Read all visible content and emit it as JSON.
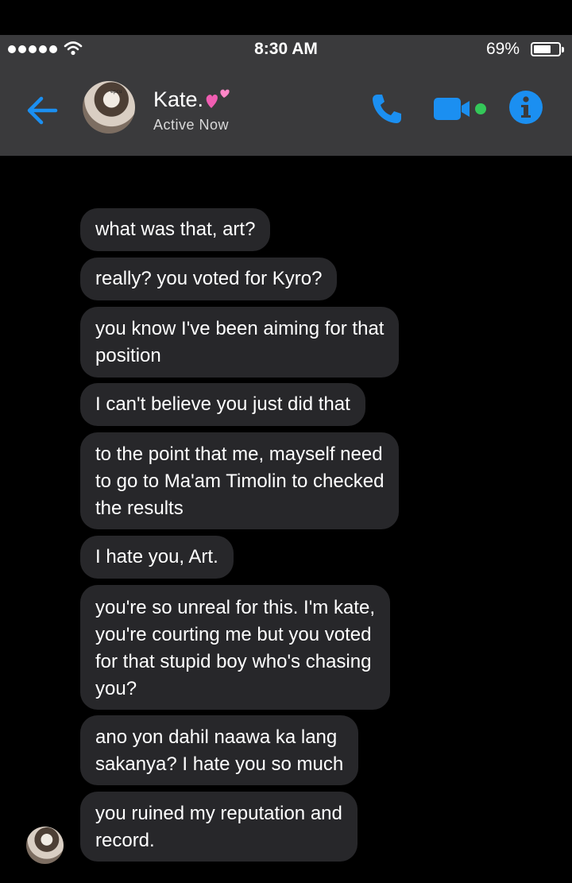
{
  "status_bar": {
    "time": "8:30 AM",
    "battery": "69%",
    "battery_level": 0.69
  },
  "header": {
    "contact_name": "Kate.",
    "contact_status": "Active Now",
    "avatar_tag": "epcu"
  },
  "messages": [
    {
      "text": "what was that, art?"
    },
    {
      "text": "really? you voted for Kyro?"
    },
    {
      "text": "you know I've been aiming for that\nposition"
    },
    {
      "text": "I can't believe you just did that"
    },
    {
      "text": "to the point that me, mayself need\nto go to Ma'am Timolin to checked\nthe results"
    },
    {
      "text": "I hate you, Art."
    },
    {
      "text": "you're so unreal for this. I'm kate,\nyou're courting me but you voted\nfor that stupid boy who's chasing\nyou?"
    },
    {
      "text": "ano yon dahil naawa ka lang\nsakanya? I hate you so much"
    },
    {
      "text": "you ruined my reputation and\nrecord."
    }
  ],
  "colors": {
    "accent": "#1b8ff1",
    "online": "#34c759",
    "bubble": "#27272a",
    "header": "#3a3a3c"
  }
}
